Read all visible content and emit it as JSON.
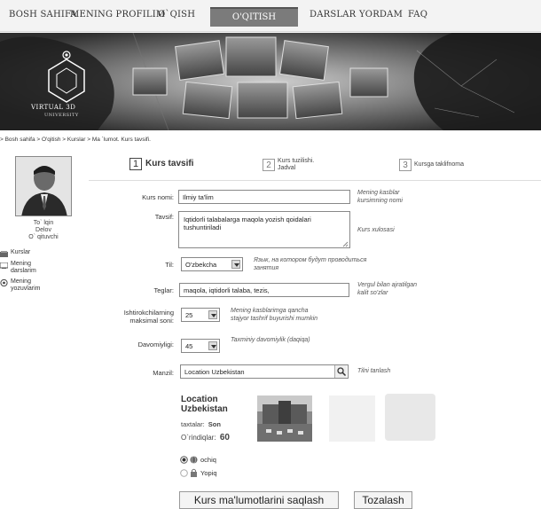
{
  "nav": {
    "items": [
      "BOSH SAHIFA",
      "MENING PROFILIM",
      "O`QISH",
      "O'QITISH",
      "DARSLAR",
      "YORDAM",
      "FAQ"
    ],
    "active": "O'QITISH"
  },
  "banner": {
    "logo_title": "VIRTUAL 3D",
    "logo_subtitle": "UNIVERSITY"
  },
  "breadcrumb": "> Bosh sahifa > O'qitish > Kurslar > Ma `lumot. Kurs tavsifi.",
  "user": {
    "first": "To` lqin",
    "last": "Delov",
    "role": "O` qituvchi"
  },
  "sidebar": [
    {
      "label": "Kurslar",
      "icon": "books-icon"
    },
    {
      "label": "Mening darslarim",
      "icon": "monitor-icon"
    },
    {
      "label": "Mening yozuvlarim",
      "icon": "eye-icon"
    }
  ],
  "steps": [
    {
      "num": "1",
      "label": "Kurs tavsifi"
    },
    {
      "num": "2",
      "label": "Kurs tuzilishi. Jadval"
    },
    {
      "num": "3",
      "label": "Kursga taklifnoma"
    }
  ],
  "form": {
    "name_label": "Kurs nomi:",
    "name_value": "Ilmiy ta'lim",
    "name_hint": "Mening kasblar kursimning nomi",
    "desc_label": "Tavsif:",
    "desc_value": "Iqtidorli talabalarga maqola yozish qoidalari tushuntiriladi",
    "desc_hint": "Kurs xulosasi",
    "lang_label": "Til:",
    "lang_value": "O'zbekcha",
    "lang_hint": "Язык, на котором будут проводиться занятия",
    "tags_label": "Teglar:",
    "tags_value": "maqola, iqtidorli talaba, tezis,",
    "tags_hint": "Vergul bilan ajratilgan kalit so'zlar",
    "max_label": "Ishtirokchilarning maksimal soni:",
    "max_value": "25",
    "max_hint": "Mening kasblarimga qancha stajyor tashrif buyurishi mumkin",
    "dur_label": "Davomiyligi:",
    "dur_value": "45",
    "dur_hint": "Taxminiy davomiylik (daqiqa)",
    "loc_label": "Manzil:",
    "loc_value": "Location Uzbekistan",
    "loc_hint": "Tilni tanlash"
  },
  "location_card": {
    "title": "Location Uzbekistan",
    "tables_label": "taxtalar:",
    "tables_value": "Son",
    "seats_label": "O`rindiqlar:",
    "seats_value": "60"
  },
  "visibility": {
    "open_label": "ochiq",
    "closed_label": "Yopiq",
    "selected": "ochiq"
  },
  "buttons": {
    "save": "Kurs ma'lumotlarini saqlash",
    "clear": "Tozalash"
  }
}
